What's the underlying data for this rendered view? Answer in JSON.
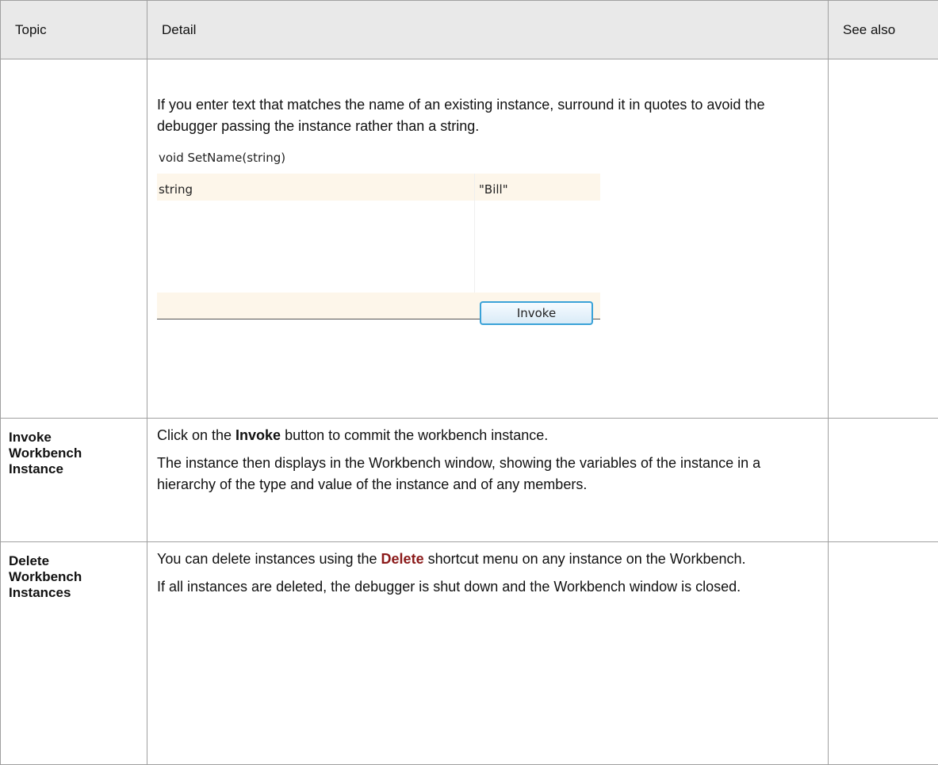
{
  "header": {
    "topic": "Topic",
    "detail": "Detail",
    "see_also": "See also"
  },
  "row1": {
    "detail_text": "If you enter text that matches the name of an existing instance, surround it in quotes to avoid the debugger passing the instance rather than a string.",
    "dialog": {
      "signature": "void SetName(string)",
      "param_name": "string",
      "param_value": "\"Bill\"",
      "invoke_button": "Invoke"
    }
  },
  "row2": {
    "topic_line1": "Invoke",
    "topic_line2": "Workbench",
    "topic_line3": "Instance",
    "p1_pre": "Click on the ",
    "p1_bold": "Invoke",
    "p1_post": " button to commit the workbench instance.",
    "p2": "The instance then displays in the Workbench window, showing the variables of the instance in a hierarchy of the type and value of the instance and of any members."
  },
  "row3": {
    "topic_line1": "Delete",
    "topic_line2": "Workbench",
    "topic_line3": "Instances",
    "p1_pre": "You can delete instances using the ",
    "p1_bold": "Delete",
    "p1_post": " shortcut menu on any instance on the Workbench.",
    "p2": "If all instances are deleted, the debugger is shut down and the Workbench window is closed."
  },
  "colors": {
    "link_red": "#8b1a1a",
    "header_bg": "#e9e9e9",
    "dialog_row_bg": "#fdf6ea",
    "button_border": "#3aa2d8"
  }
}
